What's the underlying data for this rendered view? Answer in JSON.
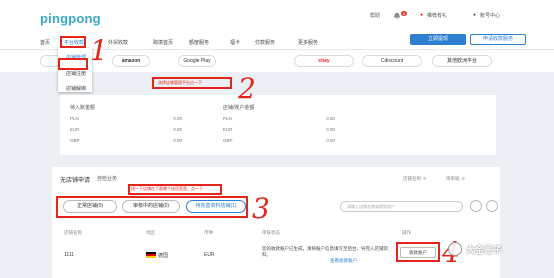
{
  "brand": {
    "logo": "pingpong",
    "accent": "#2f7fd1",
    "annotation_color": "#e2261c"
  },
  "top_right": {
    "help": "帮助",
    "notifications_count": "4",
    "recommend": "推荐有礼",
    "account": "账号中心"
  },
  "nav": {
    "items": [
      "首页",
      "平台收款",
      "外贸收款",
      "跨境首页",
      "额度服务",
      "福卡",
      "付款服务",
      "更多服务"
    ],
    "btn_withdraw": "立即提现",
    "btn_apply": "申请收款服务"
  },
  "dropdown": {
    "items": [
      "店铺管理",
      "店铺注册",
      "店铺解绑"
    ]
  },
  "platforms": [
    "amazon",
    "Google Play",
    "ebay",
    "Cdiscount",
    "其他欧洲平台"
  ],
  "balances": {
    "left_title": "待入账金额",
    "right_title": "店铺/账户金额",
    "rows": [
      {
        "cur": "PLN",
        "left": "0.00",
        "right": "0.00"
      },
      {
        "cur": "EUR",
        "left": "0.00",
        "right": "0.00"
      },
      {
        "cur": "GBP",
        "left": "0.00",
        "right": "0.00"
      }
    ]
  },
  "section": {
    "title": "无店铺申请",
    "link": "自检业务",
    "info_right_1": "店铺名称: 0",
    "info_right_2": "待审核: 0"
  },
  "tabs": [
    "正常店铺(0)",
    "审核中的店铺(0)",
    "待完善资料店铺(1)"
  ],
  "search_placeholder": "请输入店铺名称或收款账户",
  "table": {
    "headers": [
      "店铺名称",
      "地区",
      "币种",
      "审核状态",
      "操作"
    ],
    "row": {
      "name": "1111",
      "region": "德国",
      "currency": "EUR",
      "status": "您的收款账户已生成，请将账户信息填写至后台，导完入店铺资料。",
      "status_link": "查看收款账户",
      "action": "收款账户"
    }
  },
  "annotations": {
    "note_2": "选择店铺管理平台点一下",
    "note_3": "找一下店铺在下面哪个选项里面，点一下",
    "num_1": "1",
    "num_2": "2",
    "num_3": "3",
    "num_4": "4"
  },
  "watermark": "大金哥子"
}
